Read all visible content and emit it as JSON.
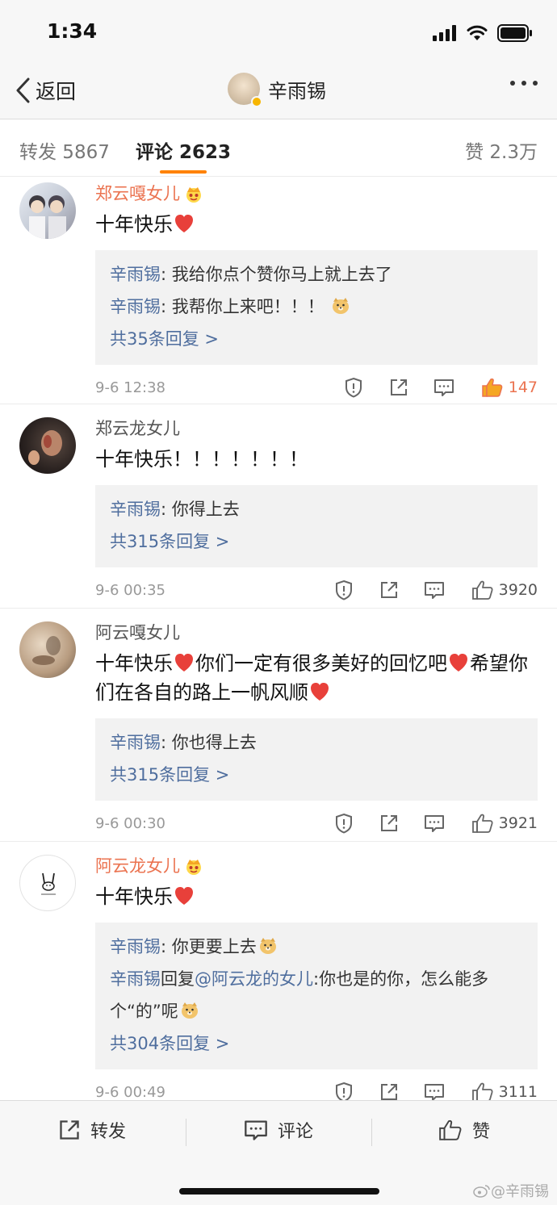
{
  "status": {
    "time": "1:34"
  },
  "nav": {
    "back_label": "返回",
    "title": "辛雨锡"
  },
  "tabs": [
    {
      "label": "转发 5867"
    },
    {
      "label": "评论 2623"
    },
    {
      "label": "赞 2.3万"
    }
  ],
  "comments": [
    {
      "name": "郑云嘎女儿",
      "text": "十年快乐",
      "replies": [
        {
          "author": "辛雨锡",
          "sep": ": ",
          "text": "我给你点个赞你马上就上去了"
        },
        {
          "author": "辛雨锡",
          "sep": ": ",
          "text": "我帮你上来吧！！！"
        }
      ],
      "more": "共35条回复 >",
      "time": "9-6 12:38",
      "likes": "147"
    },
    {
      "name": "郑云龙女儿",
      "text": "十年快乐！！！！！！！",
      "replies": [
        {
          "author": "辛雨锡",
          "sep": ": ",
          "text": "你得上去"
        }
      ],
      "more": "共315条回复 >",
      "time": "9-6 00:35",
      "likes": "3920"
    },
    {
      "name": "阿云嘎女儿",
      "text_part1": "十年快乐",
      "text_part2": "你们一定有很多美好的回忆吧",
      "text_part3": "希望你们在各自的路上一帆风顺",
      "replies": [
        {
          "author": "辛雨锡",
          "sep": ": ",
          "text": "你也得上去"
        }
      ],
      "more": "共315条回复 >",
      "time": "9-6 00:30",
      "likes": "3921"
    },
    {
      "name": "阿云龙女儿",
      "text": "十年快乐",
      "replies": [
        {
          "author": "辛雨锡",
          "sep": ": ",
          "text": "你更要上去"
        },
        {
          "author": "辛雨锡",
          "sep": "回复",
          "mention": "@阿云龙的女儿",
          "text": ":你也是的你，怎么能多个“的”呢"
        }
      ],
      "more": "共304条回复 >",
      "time": "9-6 00:49",
      "likes": "3111"
    }
  ],
  "bottom": {
    "repost": "转发",
    "comment": "评论",
    "like": "赞"
  },
  "watermark": "@辛雨锡",
  "colors": {
    "accent": "#ff8200",
    "vip_name": "#eb7350",
    "link": "#4f6e9e",
    "heart": "#e8403a"
  },
  "icons": [
    "back-chevron-icon",
    "more-dots-icon",
    "report-icon",
    "share-icon",
    "comment-icon",
    "thumbs-up-icon",
    "heart-icon",
    "crown-icon",
    "doge-emoji-icon"
  ]
}
